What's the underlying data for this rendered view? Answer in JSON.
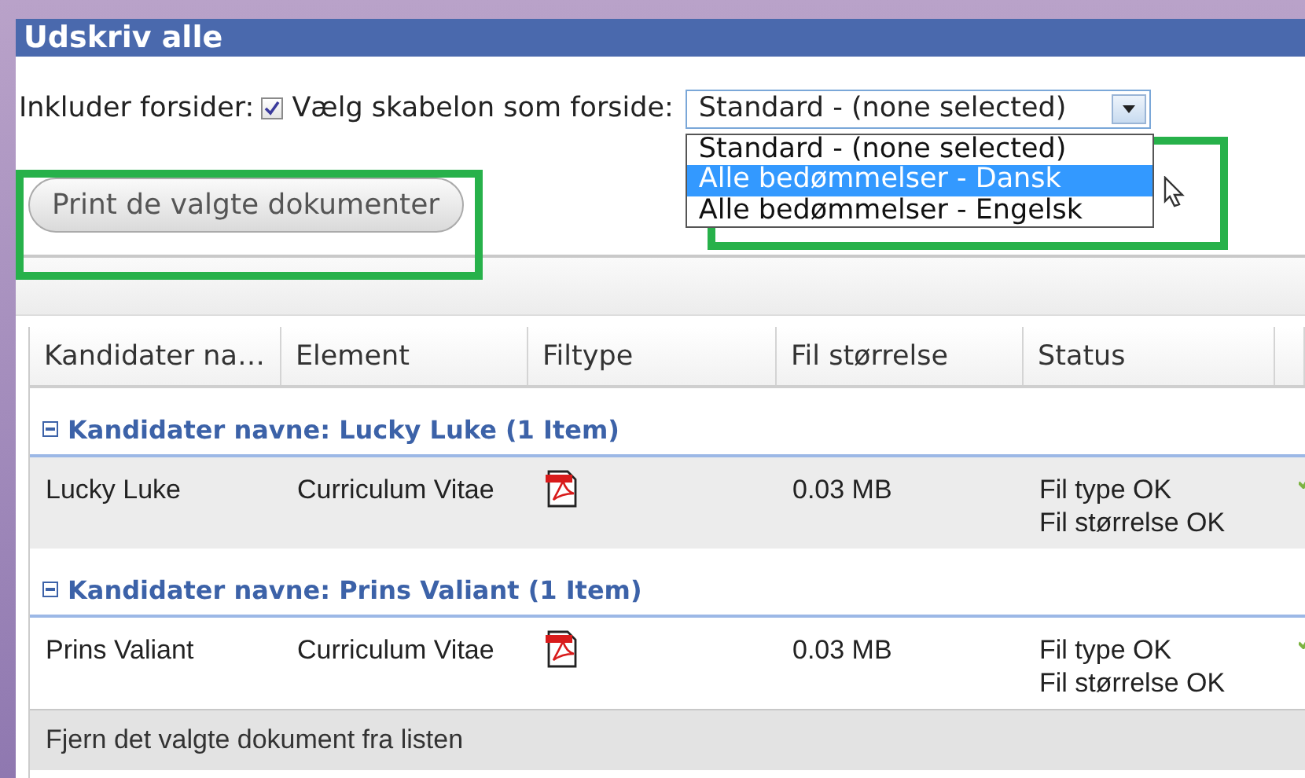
{
  "window": {
    "title": "Udskriv alle"
  },
  "options": {
    "include_label": "Inkluder forsider:",
    "include_checked": true,
    "template_label": "Vælg skabelon som forside:",
    "template_value": "Standard - (none selected)",
    "dropdown_open": true,
    "dropdown_options": [
      {
        "label": "Standard - (none selected)",
        "selected": false
      },
      {
        "label": "Alle bedømmelser - Dansk",
        "selected": true
      },
      {
        "label": "Alle bedømmelser - Engelsk",
        "selected": false
      }
    ]
  },
  "print_button": "Print de valgte dokumenter",
  "table": {
    "columns": [
      "Kandidater na…",
      "Element",
      "Filtype",
      "Fil størrelse",
      "Status"
    ],
    "groups": [
      {
        "title": "Kandidater navne: Lucky Luke (1 Item)",
        "expanded": true,
        "rows": [
          {
            "name": "Lucky Luke",
            "element": "Curriculum Vitae",
            "size": "0.03 MB",
            "status": [
              "Fil type OK",
              "Fil størrelse OK"
            ],
            "selected": true
          }
        ]
      },
      {
        "title": "Kandidater navne: Prins Valiant (1 Item)",
        "expanded": true,
        "rows": [
          {
            "name": "Prins Valiant",
            "element": "Curriculum Vitae",
            "size": "0.03 MB",
            "status": [
              "Fil type OK",
              "Fil størrelse OK"
            ],
            "selected": false
          }
        ]
      }
    ]
  },
  "footer": "Fjern det valgte dokument fra listen"
}
